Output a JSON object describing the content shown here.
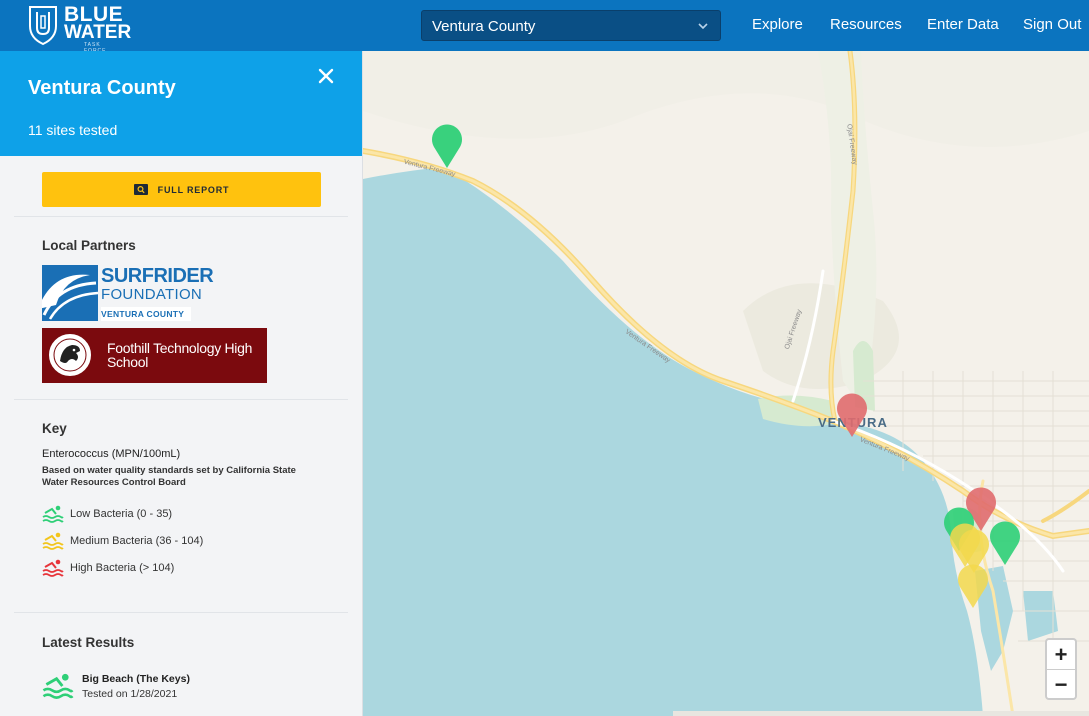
{
  "brand": {
    "line1": "BLUE",
    "line2": "WATER",
    "line3": "TASK FORCE"
  },
  "county_select": {
    "value": "Ventura County"
  },
  "nav": {
    "explore": "Explore",
    "resources": "Resources",
    "enter_data": "Enter Data",
    "sign_out": "Sign Out"
  },
  "sidebar": {
    "title": "Ventura County",
    "subtitle": "11 sites tested",
    "full_report": "FULL REPORT",
    "partners_title": "Local Partners",
    "partners": {
      "surfrider": {
        "line1": "SURFRIDER",
        "line2": "FOUNDATION",
        "line3": "VENTURA COUNTY"
      },
      "foothill": {
        "name": "Foothill Technology High School"
      }
    },
    "key": {
      "title": "Key",
      "measure": "Enterococcus (MPN/100mL)",
      "standard": "Based on water quality standards set by California State Water Resources Control Board",
      "levels": [
        {
          "label": "Low Bacteria (0 - 35)",
          "color": "#2ecf77"
        },
        {
          "label": "Medium Bacteria (36 - 104)",
          "color": "#f2c51c"
        },
        {
          "label": "High Bacteria (> 104)",
          "color": "#e7343a"
        }
      ]
    },
    "latest": {
      "title": "Latest Results",
      "items": [
        {
          "name": "Big Beach (The Keys)",
          "tested": "Tested on 1/28/2021"
        }
      ]
    }
  },
  "map": {
    "place_label": "VENTURA",
    "road_labels": {
      "ventura_fwy_1": "Ventura Freeway",
      "ventura_fwy_2": "Ventura Freeway",
      "ventura_fwy_3": "Ventura Freeway",
      "ojai_fwy_1": "Ojai Freeway",
      "ojai_fwy_2": "Ojai Freeway"
    },
    "zoom_in": "+",
    "zoom_out": "−",
    "markers": [
      {
        "status": "low",
        "color": "#2ecf77"
      },
      {
        "status": "high",
        "color": "#e06b6e"
      },
      {
        "status": "high",
        "color": "#e06b6e"
      },
      {
        "status": "low",
        "color": "#2ecf77"
      },
      {
        "status": "medium",
        "color": "#f2d84c"
      },
      {
        "status": "medium",
        "color": "#f2d84c"
      },
      {
        "status": "low",
        "color": "#2ecf77"
      },
      {
        "status": "medium",
        "color": "#f2d84c"
      }
    ]
  }
}
